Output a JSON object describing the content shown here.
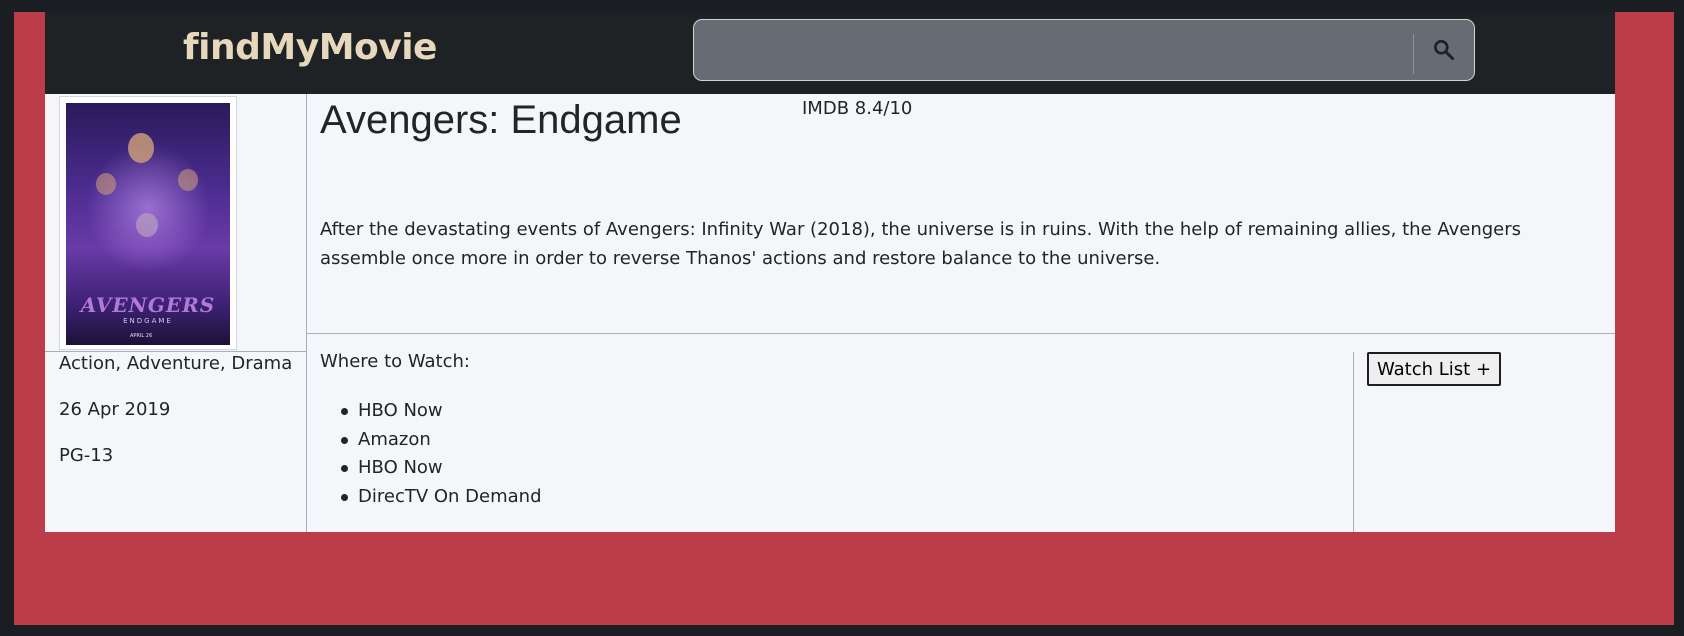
{
  "brand": {
    "name": "findMyMovie",
    "color": "#e6d7bd"
  },
  "search": {
    "value": "",
    "placeholder": "",
    "button_icon": "search-icon"
  },
  "movie": {
    "title": "Avengers: Endgame",
    "rating": "IMDB 8.4/10",
    "plot": "After the devastating events of Avengers: Infinity War (2018), the universe is in ruins. With the help of remaining allies, the Avengers assemble once more in order to reverse Thanos' actions and restore balance to the universe.",
    "genres": "Action, Adventure, Drama",
    "release_date": "26 Apr 2019",
    "rated": "PG-13",
    "poster_alt": "Avengers: Endgame poster"
  },
  "where_to_watch": {
    "heading": "Where to Watch:",
    "providers": [
      "HBO Now",
      "Amazon",
      "HBO Now",
      "DirecTV On Demand"
    ]
  },
  "actions": {
    "watchlist_label": "Watch List +"
  },
  "colors": {
    "page_background": "#bd3c4a",
    "navbar": "#1f2225",
    "search_box": "#656c73",
    "card": "#f5f6f9",
    "divider": "#a7aec2"
  }
}
